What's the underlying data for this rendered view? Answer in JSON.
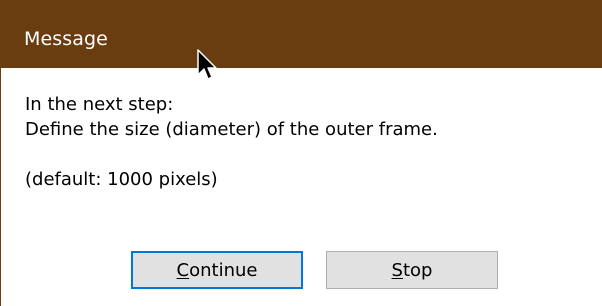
{
  "window": {
    "title": "Message",
    "titlebar_color": "#6a3d11"
  },
  "message": {
    "line1": "In the next step:",
    "line2": "Define the size (diameter) of the outer frame.",
    "line3": "(default: 1000 pixels)"
  },
  "buttons": {
    "continue": {
      "mnemonic": "C",
      "rest": "ontinue",
      "is_default": true
    },
    "stop": {
      "mnemonic": "S",
      "rest": "top",
      "is_default": false
    }
  },
  "cursor": {
    "icon": "arrow-cursor-icon"
  }
}
